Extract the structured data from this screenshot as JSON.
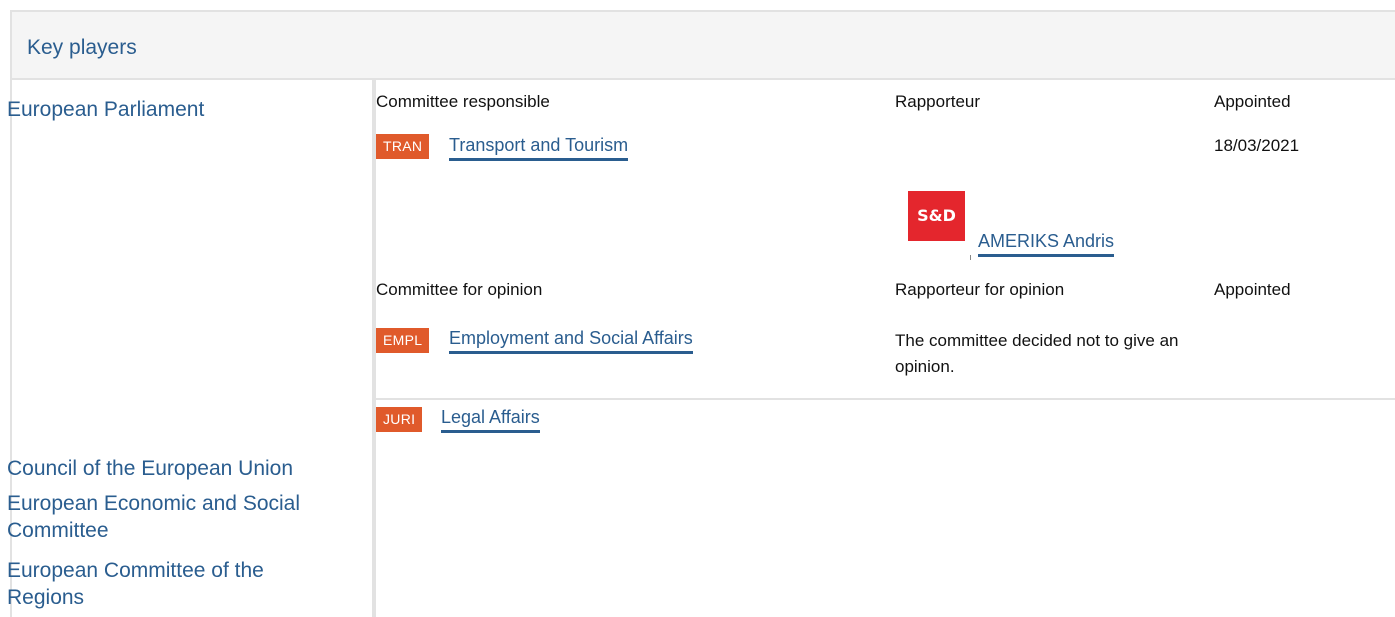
{
  "header": {
    "title": "Key players"
  },
  "left": {
    "european_parliament": "European Parliament",
    "council": "Council of the European Union",
    "eesc": "European Economic and Social Committee",
    "regions": "European Committee of the Regions"
  },
  "responsible": {
    "col_committee": "Committee responsible",
    "col_rapporteur": "Rapporteur",
    "col_appointed": "Appointed",
    "committee_code": "TRAN",
    "committee_name": "Transport and Tourism",
    "appointed_date": "18/03/2021",
    "group_logo_text": "S&D",
    "rapporteur_name": "AMERIKS Andris"
  },
  "opinion": {
    "col_committee": "Committee for opinion",
    "col_rapporteur": "Rapporteur for opinion",
    "col_appointed": "Appointed",
    "committees": [
      {
        "code": "EMPL",
        "name": "Employment and Social Affairs"
      },
      {
        "code": "JURI",
        "name": "Legal Affairs"
      }
    ],
    "decision_text": "The committee decided not to give an opinion."
  },
  "colors": {
    "link": "#2a5d8f",
    "badge": "#e05a2b",
    "group_logo": "#e4262d"
  }
}
